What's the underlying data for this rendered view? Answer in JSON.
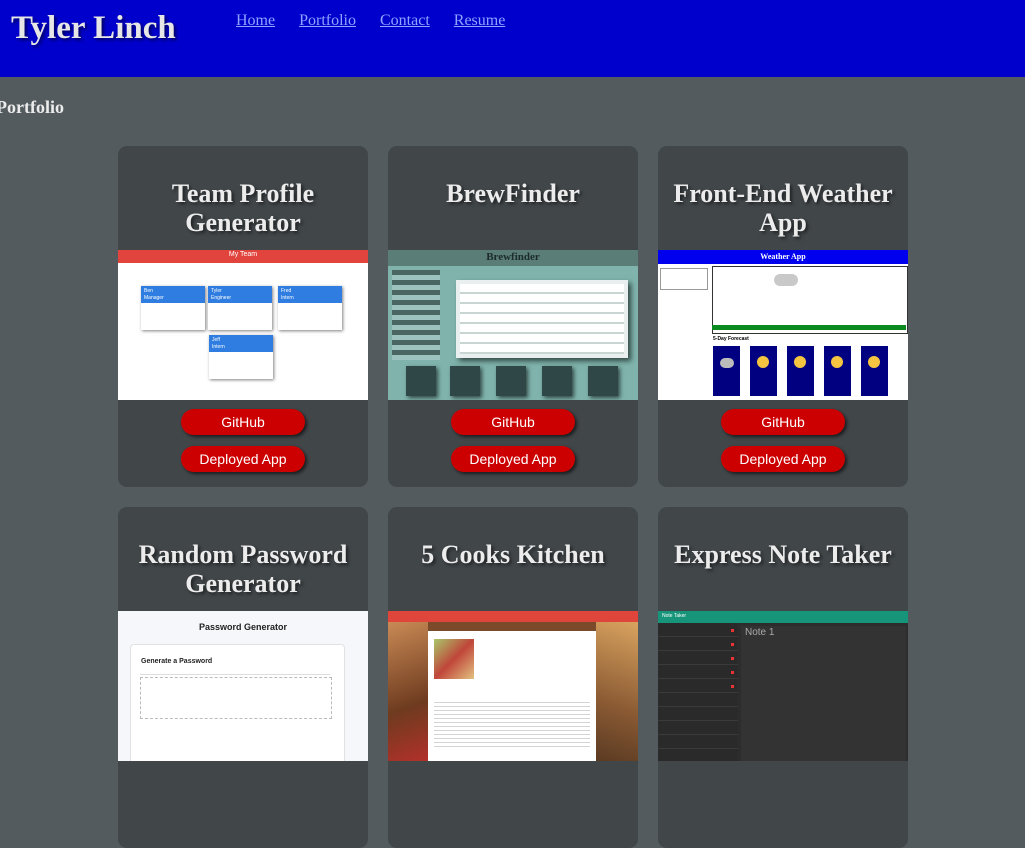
{
  "header": {
    "title": "Tyler Linch",
    "nav": [
      "Home",
      "Portfolio",
      "Contact",
      "Resume"
    ]
  },
  "section_title": "Portfolio",
  "buttons": {
    "github": "GitHub",
    "deployed": "Deployed App"
  },
  "projects": [
    {
      "title": "Team Profile Generator"
    },
    {
      "title": "BrewFinder"
    },
    {
      "title": "Front-End Weather App"
    },
    {
      "title": "Random Password Generator"
    },
    {
      "title": "5 Cooks Kitchen"
    },
    {
      "title": "Express Note Taker"
    }
  ],
  "thumbnails": {
    "team": {
      "header": "My Team",
      "cards": [
        {
          "name": "Ben",
          "role": "Manager"
        },
        {
          "name": "Tyler",
          "role": "Engineer"
        },
        {
          "name": "Fred",
          "role": "Intern"
        },
        {
          "name": "Jeff",
          "role": "Intern"
        }
      ]
    },
    "brew": {
      "header": "Brewfinder"
    },
    "weather": {
      "header": "Weather App",
      "forecast": "5-Day Forecast"
    },
    "password": {
      "header": "Password Generator",
      "subheader": "Generate a Password"
    },
    "notes": {
      "header": "Note Taker",
      "note_title": "Note 1"
    }
  },
  "colors": {
    "header_bg": "#0000cc",
    "page_bg": "#545b5e",
    "card_bg": "#414649",
    "button_bg": "#cc0000"
  }
}
